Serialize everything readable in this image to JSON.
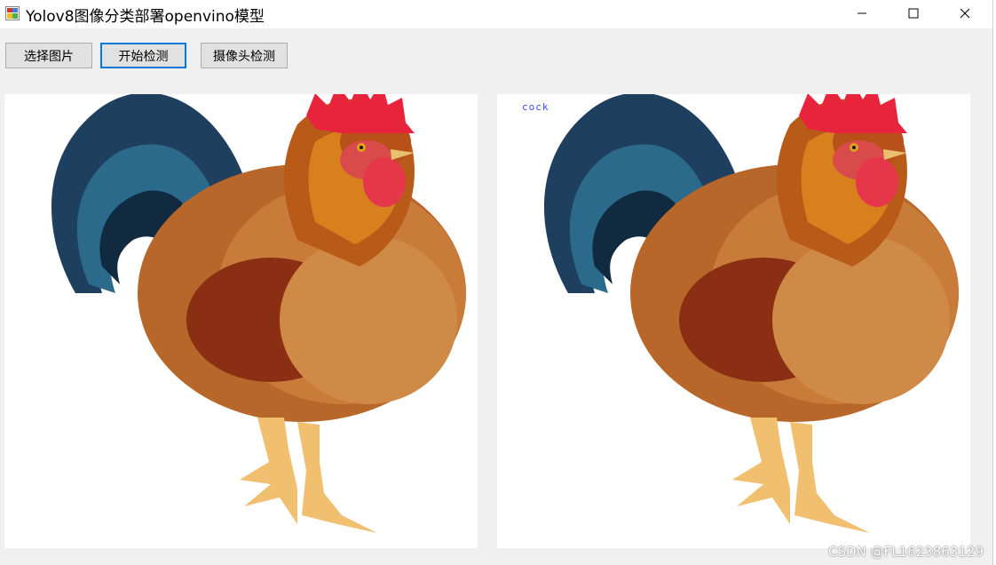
{
  "window": {
    "title": "Yolov8图像分类部署openvino模型",
    "controls": [
      "minimize-icon",
      "maximize-icon",
      "close-icon"
    ]
  },
  "toolbar": {
    "select_image_label": "选择图片",
    "start_detect_label": "开始检测",
    "camera_detect_label": "摄像头检测"
  },
  "result": {
    "class_label": "cock"
  },
  "images": {
    "source": "rooster",
    "result": "rooster"
  },
  "watermark": "CSDN @FL1623863129",
  "colors": {
    "accent": "#0078d7",
    "label_text": "#3a4bff"
  }
}
